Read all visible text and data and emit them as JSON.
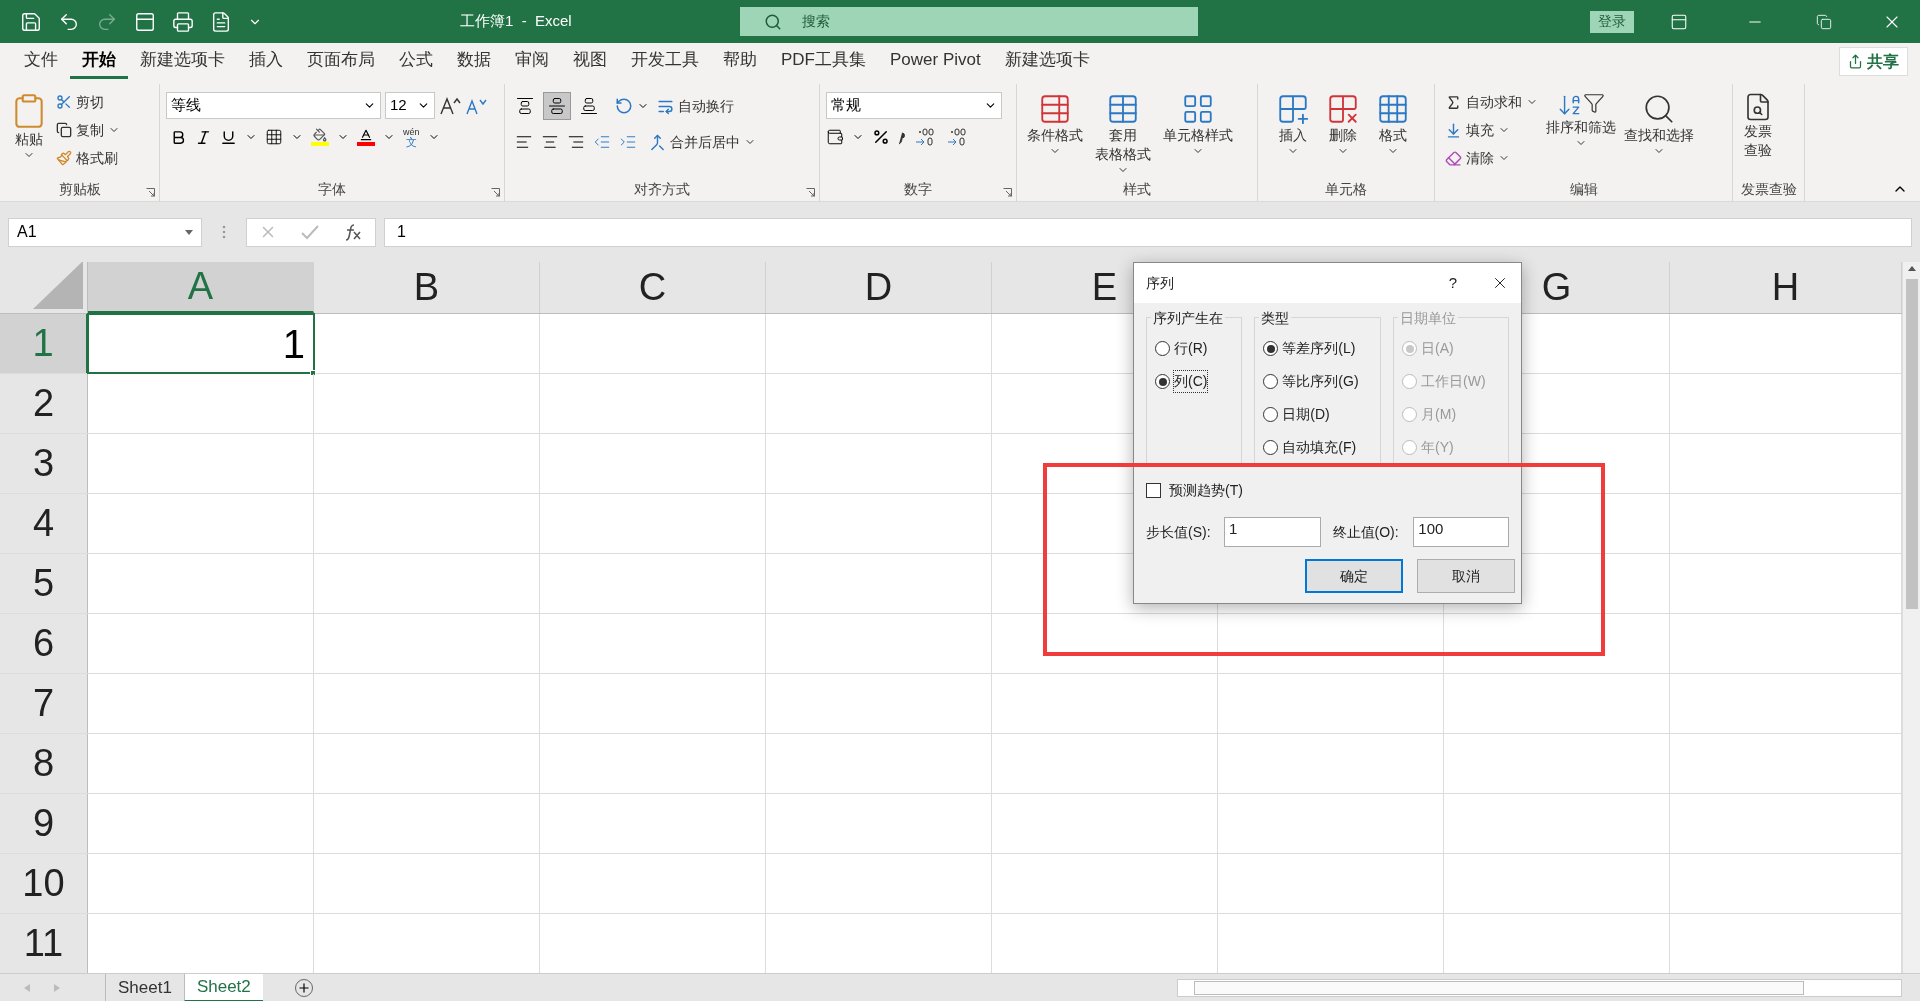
{
  "title_bar": {
    "title": "工作簿1  -  Excel",
    "search_placeholder": "搜索",
    "login": "登录"
  },
  "menu_tabs": [
    {
      "label": "文件",
      "selected": false
    },
    {
      "label": "开始",
      "selected": true
    },
    {
      "label": "新建选项卡",
      "selected": false
    },
    {
      "label": "插入",
      "selected": false
    },
    {
      "label": "页面布局",
      "selected": false
    },
    {
      "label": "公式",
      "selected": false
    },
    {
      "label": "数据",
      "selected": false
    },
    {
      "label": "审阅",
      "selected": false
    },
    {
      "label": "视图",
      "selected": false
    },
    {
      "label": "开发工具",
      "selected": false
    },
    {
      "label": "帮助",
      "selected": false
    },
    {
      "label": "PDF工具集",
      "selected": false
    },
    {
      "label": "Power Pivot",
      "selected": false
    },
    {
      "label": "新建选项卡",
      "selected": false
    }
  ],
  "share": "共享",
  "ribbon": {
    "clipboard": {
      "paste": "粘贴",
      "cut": "剪切",
      "copy": "复制",
      "format_painter": "格式刷",
      "label": "剪贴板"
    },
    "font": {
      "name": "等线",
      "size": "12",
      "phonetic_top": "wén",
      "phonetic_bottom": "文",
      "label": "字体"
    },
    "alignment": {
      "vertical": [
        {
          "selected": false
        },
        {
          "selected": true
        },
        {
          "selected": false
        }
      ],
      "wrap": "自动换行",
      "merge": "合并后居中",
      "label": "对齐方式"
    },
    "number": {
      "format": "常规",
      "label": "数字"
    },
    "styles": {
      "buttons": [
        {
          "kind": "conditional",
          "lines": [
            "条件格式"
          ]
        },
        {
          "kind": "table",
          "lines": [
            "套用",
            "表格格式"
          ]
        },
        {
          "kind": "cellstyle",
          "lines": [
            "单元格样式"
          ]
        }
      ],
      "label": "样式"
    },
    "cells": {
      "buttons": [
        {
          "kind": "insert",
          "lines": [
            "插入"
          ]
        },
        {
          "kind": "delete",
          "lines": [
            "删除"
          ]
        },
        {
          "kind": "format",
          "lines": [
            "格式"
          ]
        }
      ],
      "label": "单元格"
    },
    "editing": {
      "autosum": "自动求和",
      "fill": "填充",
      "clear": "清除",
      "sort": "排序和筛选",
      "find": "查找和选择",
      "label": "编辑"
    },
    "invoice": {
      "lines": [
        "发票",
        "查验"
      ],
      "label": "发票查验"
    }
  },
  "formula_bar": {
    "name_box": "A1",
    "formula": "1"
  },
  "sheet": {
    "columns": [
      {
        "label": "A",
        "selected": true
      },
      {
        "label": "B",
        "selected": false
      },
      {
        "label": "C",
        "selected": false
      },
      {
        "label": "D",
        "selected": false
      },
      {
        "label": "E",
        "selected": false
      },
      {
        "kind": "covered"
      },
      {
        "label": "G",
        "selected": false
      },
      {
        "label": "H",
        "selected": false
      }
    ],
    "rows": [
      {
        "label": "1",
        "selected": true,
        "cells": [
          "1"
        ]
      },
      {
        "label": "2",
        "selected": false,
        "cells": []
      },
      {
        "label": "3",
        "selected": false,
        "cells": []
      },
      {
        "label": "4",
        "selected": false,
        "cells": []
      },
      {
        "label": "5",
        "selected": false,
        "cells": []
      },
      {
        "label": "6",
        "selected": false,
        "cells": []
      },
      {
        "label": "7",
        "selected": false,
        "cells": []
      },
      {
        "label": "8",
        "selected": false,
        "cells": []
      },
      {
        "label": "9",
        "selected": false,
        "cells": []
      },
      {
        "label": "10",
        "selected": false,
        "cells": []
      },
      {
        "label": "11",
        "selected": false,
        "cells": []
      }
    ]
  },
  "sheet_tabs": [
    {
      "label": "Sheet1",
      "selected": false
    },
    {
      "label": "Sheet2",
      "selected": true
    }
  ],
  "dialog": {
    "title": "序列",
    "help": "?",
    "groups": [
      {
        "title": "序列产生在",
        "disabled": false,
        "options": [
          {
            "label": "行(R)",
            "selected": false
          },
          {
            "label": "列(C)",
            "selected": true
          }
        ]
      },
      {
        "title": "类型",
        "disabled": false,
        "options": [
          {
            "label": "等差序列(L)",
            "selected": true
          },
          {
            "label": "等比序列(G)",
            "selected": false
          },
          {
            "label": "日期(D)",
            "selected": false
          },
          {
            "label": "自动填充(F)",
            "selected": false
          }
        ]
      },
      {
        "title": "日期单位",
        "disabled": true,
        "options": [
          {
            "label": "日(A)",
            "selected": true
          },
          {
            "label": "工作日(W)",
            "selected": false
          },
          {
            "label": "月(M)",
            "selected": false
          },
          {
            "label": "年(Y)",
            "selected": false
          }
        ]
      }
    ],
    "trend": {
      "label": "预测趋势(T)",
      "checked": false
    },
    "step": {
      "label": "步长值(S):",
      "value": "1"
    },
    "stop": {
      "label": "终止值(O):",
      "value": "100"
    },
    "buttons": [
      {
        "label": "确定",
        "default": true
      },
      {
        "label": "取消",
        "default": false
      }
    ]
  },
  "annotation": {
    "kind": "highlight-box"
  }
}
